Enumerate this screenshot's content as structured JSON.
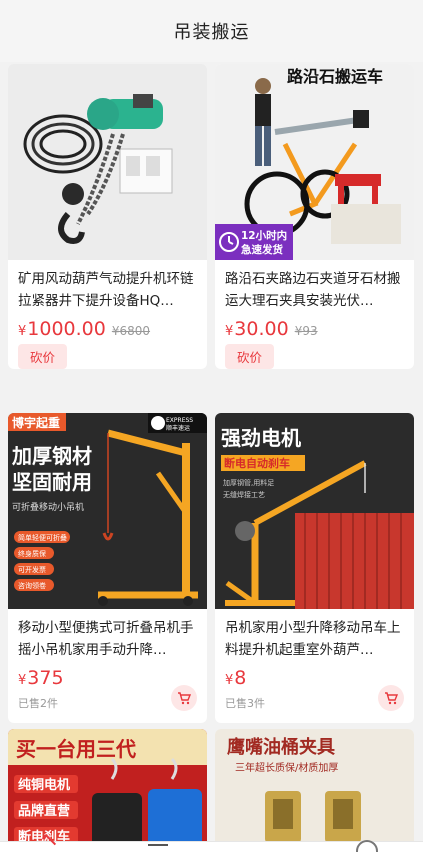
{
  "header": {
    "title": "吊装搬运"
  },
  "products": [
    {
      "name": "矿用风动葫芦气动提升机环链拉紧器井下提升设备HQ…",
      "price_symbol": "¥",
      "price": "1000.00",
      "original_price": "¥6800",
      "tag": "砍价"
    },
    {
      "name": "路沿石夹路边石夹道牙石材搬运大理石夹具安装光伏…",
      "price_symbol": "¥",
      "price": "30.00",
      "original_price": "¥93",
      "tag": "砍价",
      "image_text": {
        "headline": "路沿石搬运车",
        "badge_line1": "12小时内",
        "badge_line2": "急速发货"
      }
    },
    {
      "name": "移动小型便携式可折叠吊机手摇小吊机家用手动升降…",
      "price_symbol": "¥",
      "price": "375",
      "sold": "已售2件",
      "image_text": {
        "brand": "博宇起重",
        "headline1": "加厚钢材",
        "headline2": "坚固耐用",
        "sub": "可折叠移动小吊机",
        "sf": "EXPRESS 顺丰速运",
        "features": [
          "简单轻便可折叠",
          "终身质保",
          "可开发票",
          "咨询领卷"
        ]
      }
    },
    {
      "name": "吊机家用小型升降移动吊车上料提升机起重室外葫芦…",
      "price_symbol": "¥",
      "price": "8",
      "sold": "已售3件",
      "image_text": {
        "headline": "强劲电机",
        "sub": "断电自动刹车",
        "features": [
          "加厚钢管,用料足",
          "无缝焊接工艺"
        ]
      }
    },
    {
      "image_text": {
        "headline": "买一台用三代",
        "lines": [
          "纯铜电机",
          "品牌直营",
          "断电刹车"
        ]
      }
    },
    {
      "image_text": {
        "headline": "鹰嘴油桶夹具",
        "sub": "三年超长质保/材质加厚"
      }
    }
  ],
  "colors": {
    "price": "#e8383d",
    "accent_orange": "#f5a623",
    "bargain_bg": "#fde6e6"
  }
}
